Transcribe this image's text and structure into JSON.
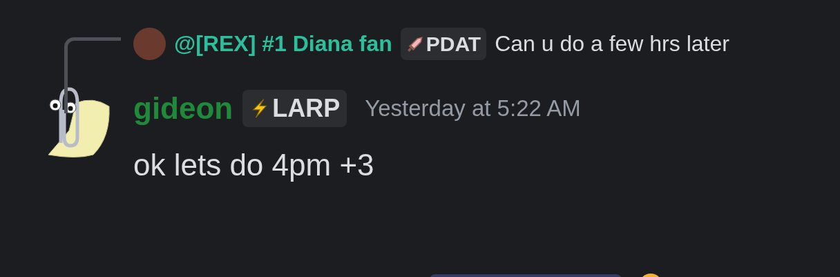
{
  "reply": {
    "author": "@[REX] #1 Diana fan",
    "badge": "PDAT",
    "text": "Can u do a few hrs later"
  },
  "message": {
    "author": "gideon",
    "badge": "LARP",
    "timestamp": "Yesterday at 5:22 AM",
    "text": "ok lets do 4pm +3"
  }
}
